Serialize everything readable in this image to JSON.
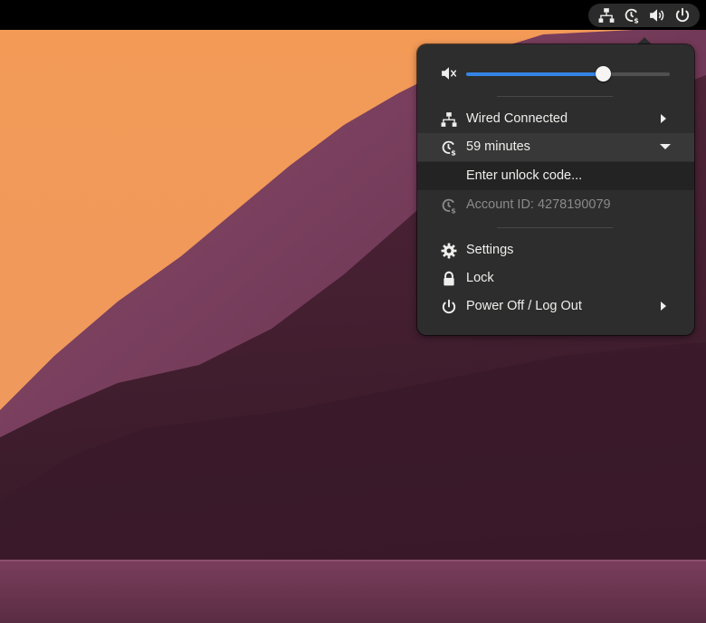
{
  "topbar": {
    "tray_icons": [
      "network-wired-icon",
      "timer-icon",
      "volume-high-icon",
      "power-icon"
    ]
  },
  "volume": {
    "icon": "volume-muted-icon",
    "level": 0.67,
    "accent": "#3584e4"
  },
  "menu": {
    "wired": {
      "label": "Wired Connected",
      "icon": "network-wired-icon"
    },
    "timer": {
      "label": "59 minutes",
      "icon": "timer-icon"
    },
    "unlock": {
      "label": "Enter unlock code..."
    },
    "account": {
      "label": "Account ID: 4278190079",
      "icon": "timer-icon"
    },
    "settings": {
      "label": "Settings",
      "icon": "gear-icon"
    },
    "lock": {
      "label": "Lock",
      "icon": "lock-icon"
    },
    "power": {
      "label": "Power Off / Log Out",
      "icon": "power-icon"
    }
  }
}
